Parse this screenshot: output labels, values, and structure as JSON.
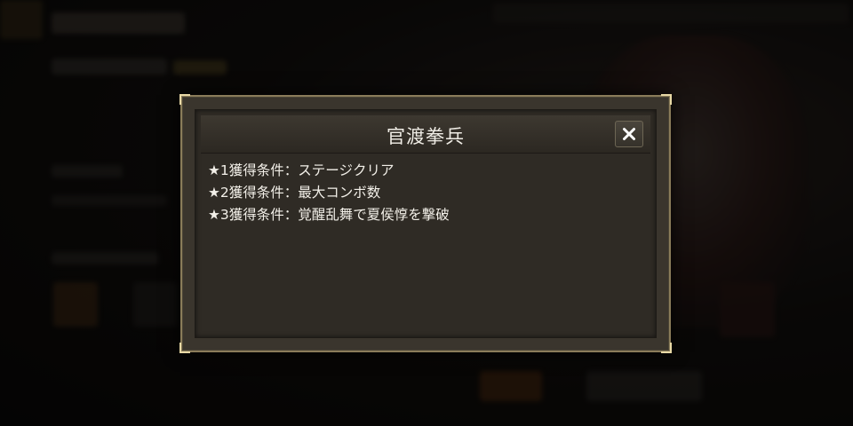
{
  "popup": {
    "title": "官渡拳兵",
    "close_icon": "close-icon",
    "conditions": [
      {
        "text": "★1獲得条件：ステージクリア"
      },
      {
        "text": "★2獲得条件：最大コンボ数"
      },
      {
        "text": "★3獲得条件：覚醒乱舞で夏侯惇を撃破"
      }
    ]
  },
  "colors": {
    "frame_gold": "#e8d9a6",
    "panel_bg": "#2f2b25",
    "text": "#f2efe8"
  }
}
